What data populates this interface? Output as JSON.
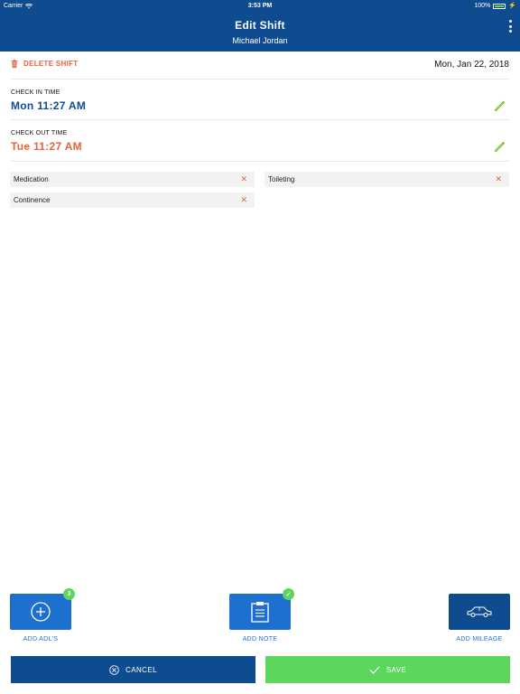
{
  "status_bar": {
    "carrier": "Carrier",
    "time": "3:53 PM",
    "battery": "100%"
  },
  "header": {
    "title": "Edit Shift",
    "subtitle": "Michael Jordan",
    "menu_icon": "kebab-menu-icon"
  },
  "shift": {
    "delete_label": "DELETE SHIFT",
    "date": "Mon, Jan 22, 2018",
    "check_in": {
      "label": "CHECK IN TIME",
      "value": "Mon 11:27 AM"
    },
    "check_out": {
      "label": "CHECK OUT TIME",
      "value": "Tue 11:27 AM"
    }
  },
  "tags": [
    {
      "label": "Medication"
    },
    {
      "label": "Toileting"
    },
    {
      "label": "Continence"
    }
  ],
  "actions": {
    "adl": {
      "label": "ADD ADL'S",
      "badge": "3",
      "icon": "plus-circle-icon"
    },
    "note": {
      "label": "ADD NOTE",
      "badge": "✓",
      "icon": "clipboard-icon"
    },
    "mileage": {
      "label": "ADD MILEAGE",
      "icon": "car-icon"
    }
  },
  "footer": {
    "cancel_label": "CANCEL",
    "save_label": "SAVE"
  },
  "colors": {
    "primary": "#0e4c8f",
    "accent_blue": "#1e70d0",
    "danger": "#e8623a",
    "success": "#5cd65c"
  }
}
